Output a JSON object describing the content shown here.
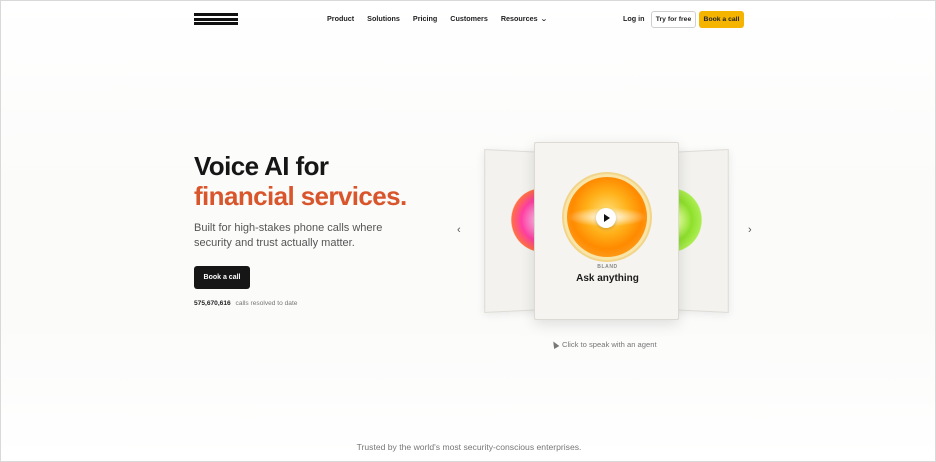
{
  "nav": {
    "links": [
      "Product",
      "Solutions",
      "Pricing",
      "Customers",
      "Resources"
    ],
    "login": "Log in",
    "try_free": "Try for free",
    "book_call": "Book a call"
  },
  "hero": {
    "title_line1": "Voice AI for",
    "title_line2": "financial services.",
    "subtitle": "Built for high-stakes phone calls where security and trust actually matter.",
    "cta": "Book a call",
    "calls_count": "575,670,616",
    "calls_label": "calls resolved to date"
  },
  "carousel": {
    "brand": "BLAND",
    "card_title": "Ask anything",
    "hint": "Click to speak with an agent",
    "prev_glyph": "‹",
    "next_glyph": "›"
  },
  "footer": {
    "trusted": "Trusted by the world's most security-conscious enterprises."
  },
  "colors": {
    "accent": "#d9552b",
    "cta_yellow": "#f4b400",
    "dark": "#161616"
  }
}
